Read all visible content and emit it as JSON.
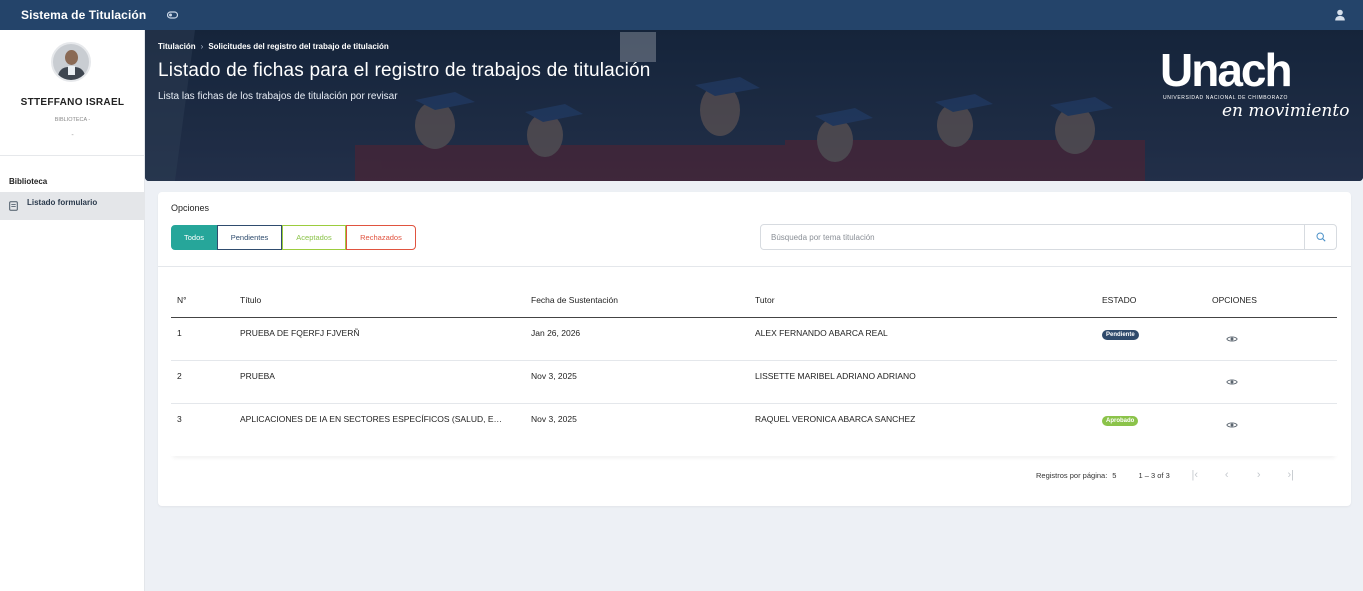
{
  "app": {
    "title": "Sistema de Titulación"
  },
  "user": {
    "name": "STTEFFANO ISRAEL",
    "role": "BIBLIOTECA -",
    "extra": "-"
  },
  "sidebar": {
    "section": "Biblioteca",
    "items": [
      {
        "label": "Listado formulario",
        "icon": "document-icon"
      }
    ]
  },
  "header": {
    "breadcrumb": [
      "Titulación",
      "Solicitudes del registro del trabajo de titulación"
    ],
    "title": "Listado de fichas para el registro de trabajos de titulación",
    "subtitle": "Lista las fichas de los trabajos de titulación por revisar",
    "logo": {
      "main": "Unach",
      "sub": "UNIVERSIDAD NACIONAL DE CHIMBORAZO",
      "tagline": "en movimiento"
    }
  },
  "options": {
    "label": "Opciones",
    "filters": [
      {
        "label": "Todos",
        "active": true
      },
      {
        "label": "Pendientes"
      },
      {
        "label": "Aceptados"
      },
      {
        "label": "Rechazados"
      }
    ],
    "search_placeholder": "Búsqueda por tema titulación"
  },
  "table": {
    "columns": [
      "N°",
      "Título",
      "Fecha de Sustentación",
      "Tutor",
      "ESTADO",
      "OPCIONES"
    ],
    "rows": [
      {
        "n": "1",
        "titulo": "PRUEBA DE FQERFJ FJVERÑ",
        "fecha": "Jan 26, 2026",
        "tutor": "ALEX FERNANDO ABARCA REAL",
        "estado": "Pendiente",
        "estado_color": "#2f4a6b"
      },
      {
        "n": "2",
        "titulo": "PRUEBA",
        "fecha": "Nov 3, 2025",
        "tutor": "LISSETTE MARIBEL ADRIANO ADRIANO",
        "estado": "",
        "estado_color": ""
      },
      {
        "n": "3",
        "titulo": "APLICACIONES DE IA EN SECTORES ESPECÍFICOS (SALUD, EDUCACIÓN, FINANZAS)",
        "fecha": "Nov 3, 2025",
        "tutor": "RAQUEL VERONICA ABARCA SANCHEZ",
        "estado": "Aprobado",
        "estado_color": "#8bc34a"
      }
    ]
  },
  "pagination": {
    "rpp_label": "Registros por página:",
    "rpp_value": "5",
    "range": "1 – 3 of 3"
  },
  "colors": {
    "topbar": "#24446a",
    "accent": "#26a69a",
    "pending": "#2f4a6b",
    "approved": "#8bc34a",
    "rejected": "#e0533f"
  }
}
